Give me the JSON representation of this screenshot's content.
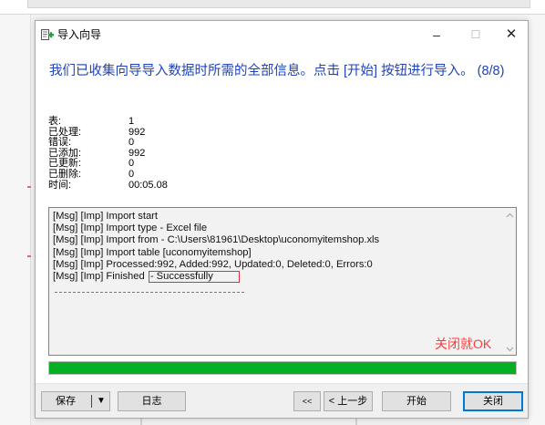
{
  "window": {
    "title": "导入向导",
    "minimize_symbol": "–",
    "maximize_symbol": "☐",
    "close_symbol": "✕"
  },
  "headline": "我们已收集向导导入数据时所需的全部信息。点击 [开始] 按钮进行导入。 (8/8)",
  "stats": [
    {
      "label": "表:",
      "value": "1"
    },
    {
      "label": "已处理:",
      "value": "992"
    },
    {
      "label": "错误:",
      "value": "0"
    },
    {
      "label": "已添加:",
      "value": "992"
    },
    {
      "label": "已更新:",
      "value": "0"
    },
    {
      "label": "已删除:",
      "value": "0"
    },
    {
      "label": "时间:",
      "value": "00:05.08"
    }
  ],
  "log": {
    "lines": [
      "[Msg] [Imp] Import start",
      "[Msg] [Imp] Import type - Excel file",
      "[Msg] [Imp] Import from - C:\\Users\\81961\\Desktop\\uconomyitemshop.xls",
      "[Msg] [Imp] Import table [uconomyitemshop]",
      "[Msg] [Imp] Processed:992, Added:992, Updated:0, Deleted:0, Errors:0"
    ],
    "finished_prefix": "[Msg] [Imp] Finished ",
    "finished_status": "- Successfully"
  },
  "annotation": "关闭就OK",
  "progress": {
    "percent": 100,
    "color": "#06b025"
  },
  "buttons": {
    "save": "保存",
    "save_dropdown": "▼",
    "log": "日志",
    "first": "<<",
    "prev": "< 上一步",
    "start": "开始",
    "close": "关闭"
  },
  "colors": {
    "headline": "#1f43b8",
    "annotation": "#ff3b3b",
    "highlight_box": "#e03030"
  },
  "icons": [
    "import-wizard-icon",
    "chevron-up-icon",
    "chevron-down-icon"
  ]
}
